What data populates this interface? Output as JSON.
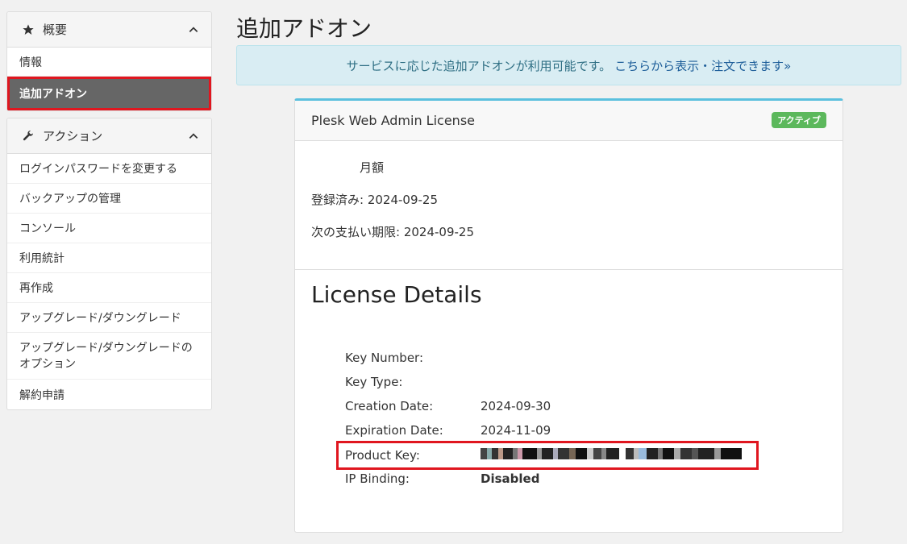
{
  "sidebar": {
    "overview": {
      "title": "概要",
      "icon": "star-icon",
      "items": [
        {
          "label": "情報"
        },
        {
          "label": "追加アドオン",
          "active": true
        }
      ]
    },
    "actions": {
      "title": "アクション",
      "icon": "wrench-icon",
      "items": [
        {
          "label": "ログインパスワードを変更する"
        },
        {
          "label": "バックアップの管理"
        },
        {
          "label": "コンソール"
        },
        {
          "label": "利用統計"
        },
        {
          "label": "再作成"
        },
        {
          "label": "アップグレード/ダウングレード"
        },
        {
          "label": "アップグレード/ダウングレードのオプション"
        },
        {
          "label": "解約申請"
        }
      ]
    }
  },
  "main": {
    "title": "追加アドオン",
    "alert": {
      "text": "サービスに応じた追加アドオンが利用可能です。",
      "link": "こちらから表示・注文できます»"
    },
    "card": {
      "title": "Plesk Web Admin License",
      "badge": "アクティブ",
      "billing_cycle": "月額",
      "registered": "登録済み: 2024-09-25",
      "next_due": "次の支払い期限: 2024-09-25",
      "details_title": "License Details",
      "details": {
        "key_number": {
          "label": "Key Number:",
          "value": ""
        },
        "key_type": {
          "label": "Key Type:",
          "value": ""
        },
        "creation_date": {
          "label": "Creation Date:",
          "value": "2024-09-30"
        },
        "expiration_date": {
          "label": "Expiration Date:",
          "value": "2024-11-09"
        },
        "product_key": {
          "label": "Product Key:",
          "value": "[redacted]"
        },
        "ip_binding": {
          "label": "IP Binding:",
          "value": "Disabled"
        }
      }
    }
  },
  "colors": {
    "highlight": "#e0161f",
    "active_nav": "#666666",
    "alert_bg": "#d9edf3",
    "badge": "#5cb85c",
    "card_top": "#5bc0de"
  }
}
